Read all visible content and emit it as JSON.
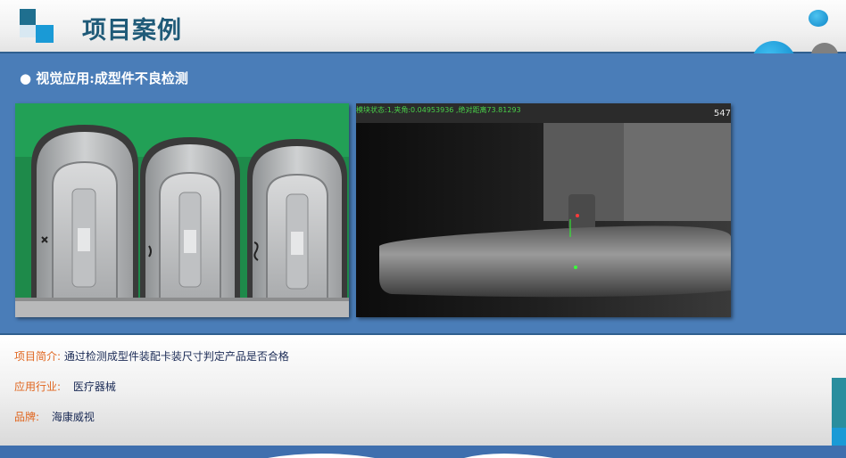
{
  "header": {
    "title": "项目案例"
  },
  "section": {
    "subtitle": "● 视觉应用:成型件不良检测"
  },
  "camera_overlay": {
    "status_text": "模块状态:1,夹角:0.04953936 ,绝对距离73.81293",
    "corner_number": "547"
  },
  "info": {
    "intro_label": "项目简介:",
    "intro_value": "通过检测成型件装配卡装尺寸判定产品是否合格",
    "industry_label": "应用行业:",
    "industry_value": "医疗器械",
    "brand_label": "品牌:",
    "brand_value": "海康威视"
  },
  "colors": {
    "title": "#1f5a78",
    "band": "#4a7db8",
    "label_orange": "#e0661f",
    "value_navy": "#1a2a55",
    "circle_blue": "#1a9ad6",
    "circle_gray": "#808080"
  },
  "icons": [
    "logo-squares-icon",
    "decorative-circles-icon"
  ]
}
